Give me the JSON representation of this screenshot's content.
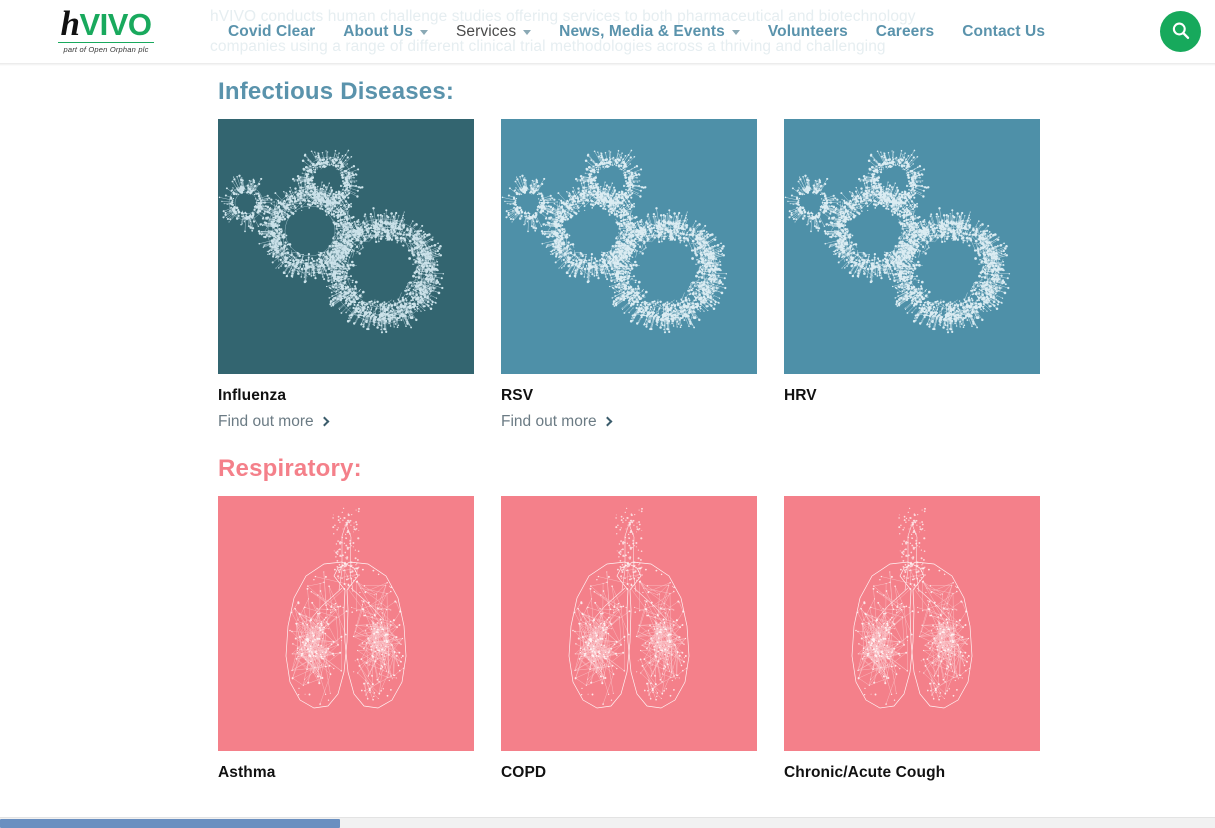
{
  "header": {
    "logo": {
      "mark_h": "h",
      "mark_vivo": "VIVO",
      "tagline": "part of Open Orphan plc"
    },
    "nav": [
      {
        "label": "Covid Clear",
        "has_dropdown": false,
        "style": "bold"
      },
      {
        "label": "About Us",
        "has_dropdown": true,
        "style": "bold"
      },
      {
        "label": "Services",
        "has_dropdown": true,
        "style": "plain"
      },
      {
        "label": "News, Media & Events",
        "has_dropdown": true,
        "style": "bold"
      },
      {
        "label": "Volunteers",
        "has_dropdown": false,
        "style": "bold"
      },
      {
        "label": "Careers",
        "has_dropdown": false,
        "style": "bold"
      },
      {
        "label": "Contact Us",
        "has_dropdown": false,
        "style": "bold"
      }
    ],
    "search_icon": "search-icon",
    "accent_green": "#17a95c",
    "nav_link_color": "#5a93ac"
  },
  "hero_ghost": {
    "line1": "hVIVO conducts human challenge studies offering services to both pharmaceutical and biotechnology",
    "line2": "companies using a range of different clinical trial methodologies across a thriving and challenging"
  },
  "sections": [
    {
      "title": "Infectious Diseases:",
      "title_color": "#5a93ac",
      "cards": [
        {
          "title": "Influenza",
          "link_label": "Find out more",
          "tile_color": "#336570",
          "art": "virus"
        },
        {
          "title": "RSV",
          "link_label": "Find out more",
          "tile_color": "#4e90a8",
          "art": "virus"
        },
        {
          "title": "HRV",
          "link_label": "",
          "tile_color": "#4e90a8",
          "art": "virus"
        }
      ]
    },
    {
      "title": "Respiratory:",
      "title_color": "#f4808a",
      "cards": [
        {
          "title": "Asthma",
          "link_label": "",
          "tile_color": "#f4808a",
          "art": "lungs"
        },
        {
          "title": "COPD",
          "link_label": "",
          "tile_color": "#f4808a",
          "art": "lungs"
        },
        {
          "title": "Chronic/Acute Cough",
          "link_label": "",
          "tile_color": "#f4808a",
          "art": "lungs"
        }
      ]
    }
  ]
}
